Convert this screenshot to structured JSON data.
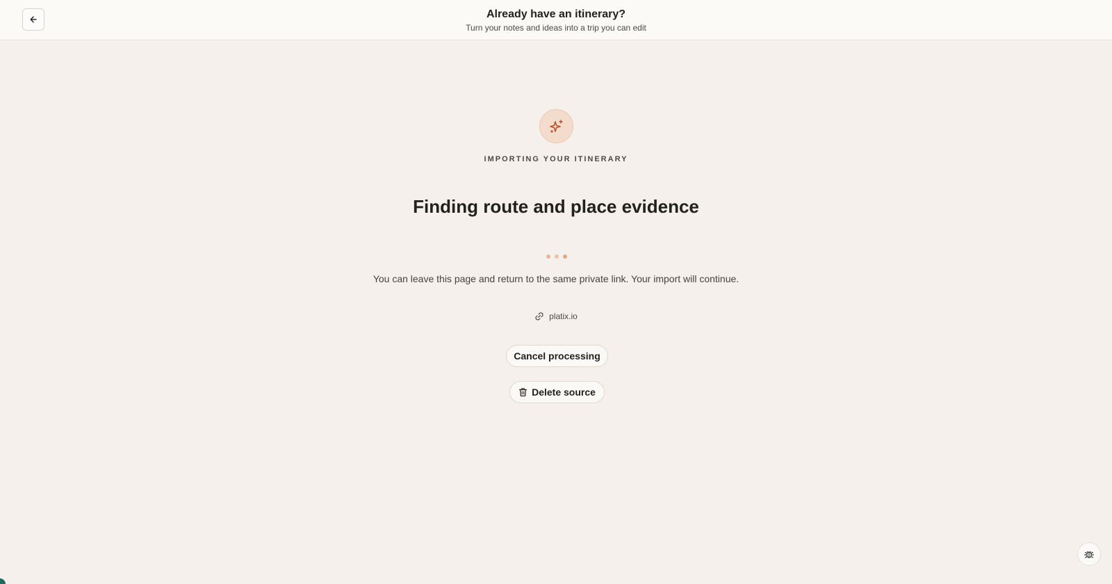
{
  "header": {
    "title": "Already have an itinerary?",
    "subtitle": "Turn your notes and ideas into a trip you can edit",
    "back_icon": "arrow-left-icon"
  },
  "status": {
    "icon": "sparkles-icon",
    "eyebrow": "IMPORTING YOUR ITINERARY",
    "headline": "Finding route and place evidence",
    "note": "You can leave this page and return to the same private link. Your import will continue."
  },
  "source": {
    "icon": "link-icon",
    "label": "platix.io"
  },
  "actions": {
    "cancel_label": "Cancel processing",
    "delete_label": "Delete source",
    "delete_icon": "trash-icon"
  },
  "debug": {
    "icon": "bug-icon"
  },
  "colors": {
    "background": "#f5f0eb",
    "accent": "#c0552b",
    "accent_soft": "#f3dccb",
    "text": "#22211d"
  }
}
